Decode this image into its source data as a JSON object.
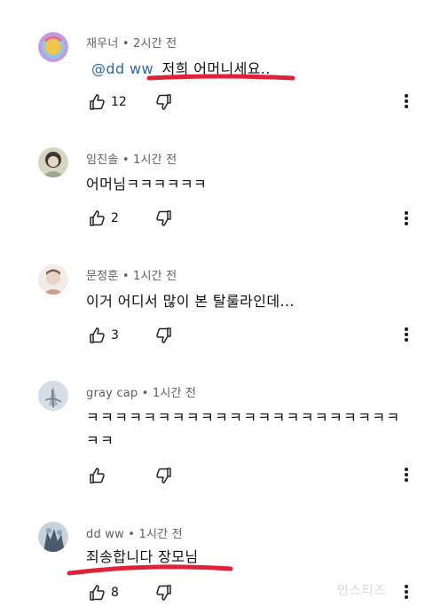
{
  "comments": [
    {
      "author": "재우너",
      "time": "2시간 전",
      "mention": "@dd ww",
      "text": "저희 어머니세요..",
      "text_line2": "",
      "likes": "12",
      "underlined": true,
      "avatar_colors": [
        "#f3c34a",
        "#8bc8e8",
        "#c49be0"
      ]
    },
    {
      "author": "임진솔",
      "time": "1시간 전",
      "mention": "",
      "text": "어머님ㅋㅋㅋㅋㅋㅋ",
      "text_line2": "",
      "likes": "2",
      "underlined": false,
      "avatar_colors": [
        "#3a3a35",
        "#9aa890",
        "#d9d3c2"
      ]
    },
    {
      "author": "문정훈",
      "time": "1시간 전",
      "mention": "",
      "text": "이거 어디서 많이 본 탈룰라인데...",
      "text_line2": "",
      "likes": "3",
      "underlined": false,
      "avatar_colors": [
        "#e9d3c4",
        "#caa08a",
        "#7a5a4a"
      ]
    },
    {
      "author": "gray cap",
      "time": "1시간 전",
      "mention": "",
      "text": "ㅋㅋㅋㅋㅋㅋㅋㅋㅋㅋㅋㅋㅋㅋㅋㅋㅋㅋㅋㅋㅋㅋ",
      "text_line2": "ㅋㅋ",
      "likes": "",
      "underlined": false,
      "avatar_colors": [
        "#d7dde6",
        "#aab6c4",
        "#6d7d90"
      ]
    },
    {
      "author": "dd ww",
      "time": "1시간 전",
      "mention": "",
      "text": "죄송합니다 장모님",
      "text_line2": "",
      "likes": "8",
      "underlined": true,
      "avatar_colors": [
        "#4b5a6b",
        "#8fa4b8",
        "#c8d2dc"
      ]
    }
  ],
  "separator": "•",
  "watermark": "인스티즈",
  "colors": {
    "meta": "#606060",
    "mention": "#2b6aa8",
    "underline": "#e0213a"
  },
  "icons": {
    "like": "thumb-up-icon",
    "dislike": "thumb-down-icon",
    "menu": "more-vert-icon"
  }
}
